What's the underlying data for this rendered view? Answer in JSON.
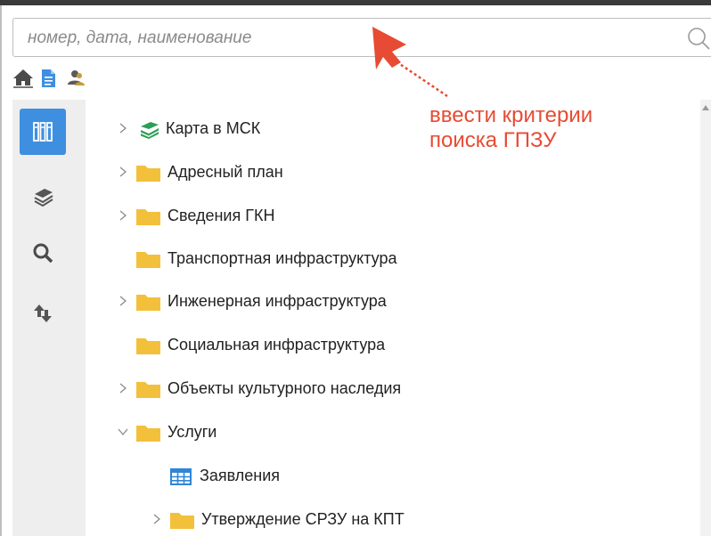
{
  "search": {
    "placeholder": "номер, дата, наименование"
  },
  "toolbar": {
    "icons": [
      "home-icon",
      "document-icon",
      "users-icon"
    ]
  },
  "leftbar": {
    "items": [
      "catalog-icon",
      "layers-icon",
      "search-icon",
      "sort-icon"
    ],
    "active": "catalog-icon"
  },
  "tree": [
    {
      "label": "Карта в МСК",
      "icon": "layers-green-icon",
      "expander": "chevron-right"
    },
    {
      "label": "Адресный план",
      "icon": "folder-icon",
      "expander": "chevron-right"
    },
    {
      "label": "Сведения ГКН",
      "icon": "folder-icon",
      "expander": "chevron-right"
    },
    {
      "label": "Транспортная инфраструктура",
      "icon": "folder-icon",
      "expander": "none"
    },
    {
      "label": "Инженерная инфраструктура",
      "icon": "folder-icon",
      "expander": "chevron-right"
    },
    {
      "label": "Социальная инфраструктура",
      "icon": "folder-icon",
      "expander": "none"
    },
    {
      "label": "Объекты культурного наследия",
      "icon": "folder-icon",
      "expander": "chevron-right"
    },
    {
      "label": "Услуги",
      "icon": "folder-icon",
      "expander": "chevron-down"
    },
    {
      "label": "Заявления",
      "icon": "table-icon",
      "expander": "none"
    },
    {
      "label": "Утверждение СРЗУ на КПТ",
      "icon": "folder-icon",
      "expander": "chevron-right"
    }
  ],
  "annotation": {
    "line1": "ввести критерии",
    "line2": "поиска ГПЗУ"
  },
  "colors": {
    "accent": "#3f8fe0",
    "folder": "#f3c03b",
    "annotation": "#e74b33",
    "layers": "#2e9e55"
  }
}
